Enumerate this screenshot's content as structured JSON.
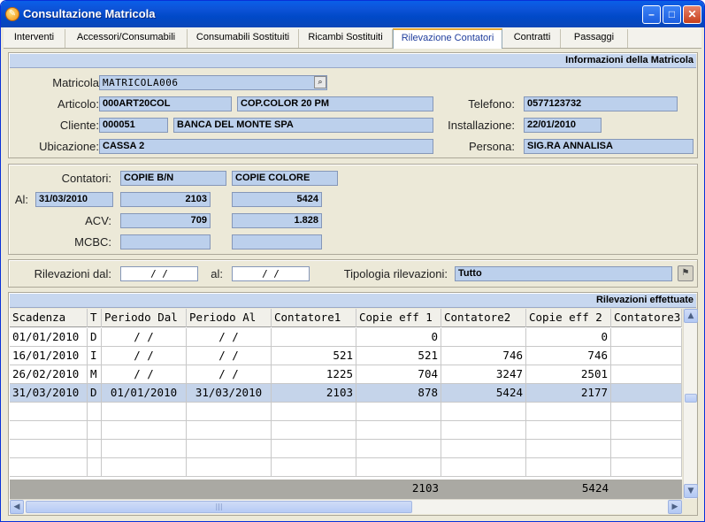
{
  "window": {
    "title": "Consultazione Matricola"
  },
  "tabs": [
    "Interventi",
    "Accessori/Consumabili",
    "Consumabili Sostituiti",
    "Ricambi Sostituiti",
    "Rilevazione Contatori",
    "Contratti",
    "Passaggi"
  ],
  "active_tab": "Rilevazione Contatori",
  "info": {
    "header": "Informazioni della Matricola",
    "matricola_label": "Matricola",
    "matricola_value": "MATRICOLA006",
    "articolo_label": "Articolo:",
    "articolo_code": "000ART20COL",
    "articolo_desc": "COP.COLOR 20 PM",
    "telefono_label": "Telefono:",
    "telefono_value": "0577123732",
    "cliente_label": "Cliente:",
    "cliente_code": "000051",
    "cliente_name": "BANCA DEL MONTE SPA",
    "installazione_label": "Installazione:",
    "installazione_value": "22/01/2010",
    "ubicazione_label": "Ubicazione:",
    "ubicazione_value": "CASSA 2",
    "persona_label": "Persona:",
    "persona_value": "SIG.RA ANNALISA"
  },
  "contatori": {
    "label": "Contatori:",
    "col1": "COPIE B/N",
    "col2": "COPIE COLORE",
    "al_label": "Al:",
    "al_date": "31/03/2010",
    "al_val1": "2103",
    "al_val2": "5424",
    "acv_label": "ACV:",
    "acv_val1": "709",
    "acv_val2": "1.828",
    "mcbc_label": "MCBC:",
    "mcbc_val1": "",
    "mcbc_val2": ""
  },
  "filter": {
    "dal_label": "Rilevazioni dal:",
    "dal_value": "  /  /",
    "al_label": "al:",
    "al_value": "  /  /",
    "tipologia_label": "Tipologia rilevazioni:",
    "tipologia_value": "Tutto"
  },
  "grid": {
    "header": "Rilevazioni effettuate",
    "columns": [
      "Scadenza",
      "T",
      "Periodo Dal",
      "Periodo Al",
      "Contatore1",
      "Copie eff 1",
      "Contatore2",
      "Copie eff 2",
      "Contatore3"
    ],
    "rows": [
      [
        "01/01/2010",
        "D",
        "  /  /",
        "  /  /",
        "",
        "0",
        "",
        "0",
        ""
      ],
      [
        "16/01/2010",
        "I",
        "  /  /",
        "  /  /",
        "521",
        "521",
        "746",
        "746",
        ""
      ],
      [
        "26/02/2010",
        "M",
        "  /  /",
        "  /  /",
        "1225",
        "704",
        "3247",
        "2501",
        ""
      ],
      [
        "31/03/2010",
        "D",
        "01/01/2010",
        "31/03/2010",
        "2103",
        "878",
        "5424",
        "2177",
        ""
      ]
    ],
    "selected_row": 3,
    "totals": {
      "copie_eff_1": "2103",
      "copie_eff_2": "5424"
    }
  },
  "colors": {
    "title_bar": "#0054e3",
    "field_bg": "#bcd0ec",
    "selected_row": "#c5d4ea",
    "active_tab_accent": "#e6a832"
  }
}
